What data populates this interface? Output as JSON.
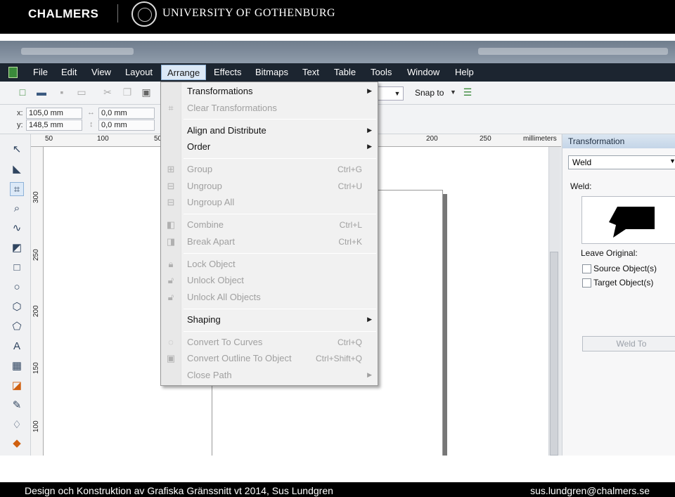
{
  "header": {
    "left_logo": "CHALMERS",
    "right_logo": "UNIVERSITY OF GOTHENBURG"
  },
  "menubar": [
    "File",
    "Edit",
    "View",
    "Layout",
    "Arrange",
    "Effects",
    "Bitmaps",
    "Text",
    "Table",
    "Tools",
    "Window",
    "Help"
  ],
  "toolbar": {
    "snap_to": "Snap to"
  },
  "propbar": {
    "x_label": "x:",
    "x_value": "105,0 mm",
    "y_label": "y:",
    "y_value": "148,5 mm",
    "w_value": "0,0 mm",
    "h_value": "0,0 mm"
  },
  "ruler": {
    "h_labels": [
      "50",
      "100",
      "50",
      "200",
      "250"
    ],
    "units": "millimeters",
    "v_labels": [
      "300",
      "250",
      "200",
      "150",
      "100"
    ]
  },
  "docker": {
    "title": "Transformation",
    "mode": "Weld",
    "weld_label": "Weld:",
    "leave_original": "Leave Original:",
    "source": "Source Object(s)",
    "target": "Target Object(s)",
    "button": "Weld To"
  },
  "arrange_menu": {
    "transformations": "Transformations",
    "clear_transformations": "Clear Transformations",
    "align_distribute": "Align and Distribute",
    "order": "Order",
    "group": "Group",
    "group_sc": "Ctrl+G",
    "ungroup": "Ungroup",
    "ungroup_sc": "Ctrl+U",
    "ungroup_all": "Ungroup All",
    "combine": "Combine",
    "combine_sc": "Ctrl+L",
    "break_apart": "Break  Apart",
    "break_apart_sc": "Ctrl+K",
    "lock_object": "Lock Object",
    "unlock_object": "Unlock Object",
    "unlock_all": "Unlock All Objects",
    "shaping": "Shaping",
    "convert_curves": "Convert To Curves",
    "convert_curves_sc": "Ctrl+Q",
    "convert_outline": "Convert Outline To Object",
    "convert_outline_sc": "Ctrl+Shift+Q",
    "close_path": "Close Path"
  },
  "footer": {
    "left": "Design och Konstruktion av Grafiska Gränssnitt vt 2014, Sus Lundgren",
    "right": "sus.lundgren@chalmers.se"
  }
}
